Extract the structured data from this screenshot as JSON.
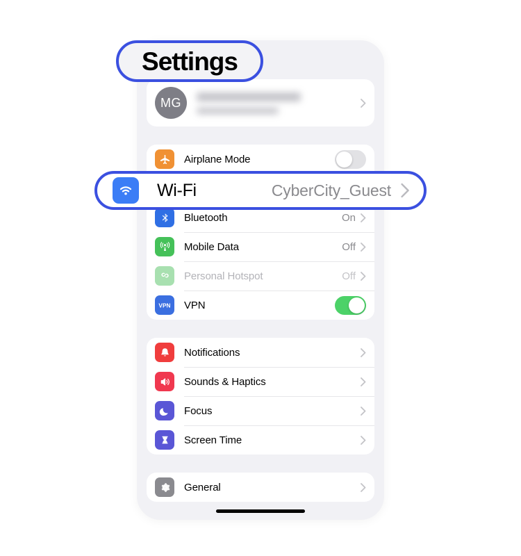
{
  "app": {
    "title": "Settings",
    "home_indicator": true
  },
  "callouts": {
    "title_pill": {
      "label": "Settings",
      "border_color": "#3b50e0"
    },
    "wifi_row": {
      "label": "Wi-Fi",
      "value": "CyberCity_Guest",
      "icon": "wifi-icon",
      "border_color": "#3b50e0",
      "chevron": "chevron-right-icon"
    }
  },
  "profile": {
    "initials": "MG",
    "name_redacted": true,
    "chevron": "chevron-right-icon"
  },
  "groups": [
    {
      "name": "connectivity",
      "rows": [
        {
          "label": "Airplane Mode",
          "icon": "airplane-icon",
          "icon_color": "#f09134",
          "control": "toggle",
          "toggle_on": false
        },
        {
          "label": "Wi-Fi",
          "icon": "wifi-icon",
          "icon_color": "#3b7df6",
          "value": "CyberCity_Guest",
          "control": "chevron"
        },
        {
          "label": "Bluetooth",
          "icon": "bluetooth-icon",
          "icon_color": "#2f6fe4",
          "value": "On",
          "control": "chevron"
        },
        {
          "label": "Mobile Data",
          "icon": "cellular-icon",
          "icon_color": "#45c159",
          "value": "Off",
          "control": "chevron"
        },
        {
          "label": "Personal Hotspot",
          "icon": "hotspot-icon",
          "icon_color": "#a8e0b0",
          "value": "Off",
          "control": "chevron",
          "disabled": true
        },
        {
          "label": "VPN",
          "icon": "vpn-icon",
          "icon_color": "#3b6fe0",
          "control": "toggle",
          "toggle_on": true
        }
      ]
    },
    {
      "name": "alerts",
      "rows": [
        {
          "label": "Notifications",
          "icon": "bell-icon",
          "icon_color": "#f03d3d",
          "control": "chevron"
        },
        {
          "label": "Sounds & Haptics",
          "icon": "speaker-icon",
          "icon_color": "#f0384f",
          "control": "chevron"
        },
        {
          "label": "Focus",
          "icon": "moon-icon",
          "icon_color": "#5a56d6",
          "control": "chevron"
        },
        {
          "label": "Screen Time",
          "icon": "hourglass-icon",
          "icon_color": "#5a56d6",
          "control": "chevron"
        }
      ]
    },
    {
      "name": "system",
      "rows": [
        {
          "label": "General",
          "icon": "gear-icon",
          "icon_color": "#8a8a8f",
          "control": "chevron"
        }
      ]
    }
  ]
}
